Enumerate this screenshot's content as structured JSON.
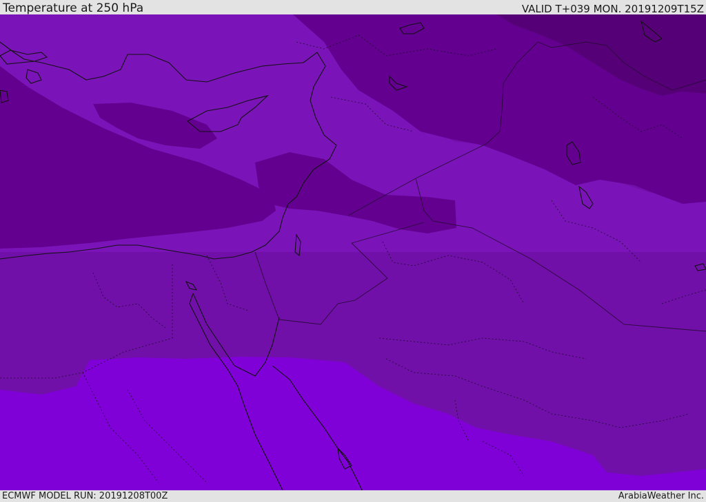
{
  "header": {
    "title": "Temperature at 250 hPa",
    "valid": "VALID T+039 MON. 20191209T15Z"
  },
  "footer": {
    "model_run": "ECMWF MODEL RUN: 20191208T00Z",
    "credit": "ArabiaWeather Inc."
  },
  "palette": {
    "band_darkest": "#560078",
    "band_dark": "#640090",
    "band_mid": "#7010a8",
    "band_light": "#7b14b8",
    "band_lightest": "#8000d8",
    "coastline": "#111111",
    "border": "#2a0a3a"
  }
}
